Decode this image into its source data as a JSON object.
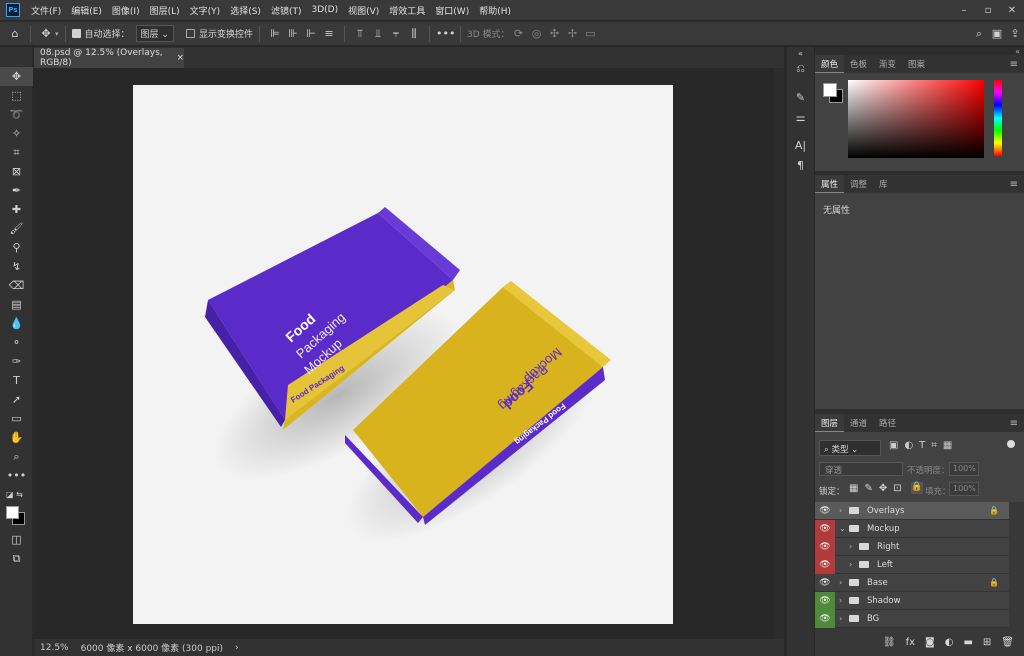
{
  "app": {
    "logo": "Ps"
  },
  "menu": [
    "文件(F)",
    "编辑(E)",
    "图像(I)",
    "图层(L)",
    "文字(Y)",
    "选择(S)",
    "滤镜(T)",
    "3D(D)",
    "视图(V)",
    "增效工具",
    "窗口(W)",
    "帮助(H)"
  ],
  "window_controls": {
    "minimize": "–",
    "restore": "▫",
    "close": "✕"
  },
  "options": {
    "auto_select_label": "自动选择：",
    "auto_select_value": "图层",
    "transform_label": "显示变换控件",
    "mode_3d": "3D 模式："
  },
  "document_tab": {
    "title": "08.psd @ 12.5% (Overlays, RGB/8)",
    "close": "×"
  },
  "status": {
    "zoom": "12.5%",
    "info": "6000 像素 x 6000 像素 (300 ppi)",
    "arrow": "›"
  },
  "color_panel": {
    "tabs": [
      "颜色",
      "色板",
      "渐变",
      "图案"
    ],
    "foreground": "#ffffff",
    "background": "#000000"
  },
  "properties_panel": {
    "tabs": [
      "属性",
      "调整",
      "库"
    ],
    "empty_text": "无属性"
  },
  "layers_panel": {
    "tabs": [
      "图层",
      "通道",
      "路径"
    ],
    "filter_kind": "类型",
    "blend_mode": "穿透",
    "opacity_label": "不透明度：",
    "opacity_value": "100%",
    "lock_label": "锁定：",
    "fill_label": "填充：",
    "fill_value": "100%"
  },
  "layers": [
    {
      "name": "Overlays",
      "indent": 0,
      "expanded": false,
      "locked": true,
      "tag": "none",
      "selected": true
    },
    {
      "name": "Mockup",
      "indent": 0,
      "expanded": true,
      "locked": false,
      "tag": "red",
      "selected": false
    },
    {
      "name": "Right",
      "indent": 1,
      "expanded": false,
      "locked": false,
      "tag": "red",
      "selected": false
    },
    {
      "name": "Left",
      "indent": 1,
      "expanded": false,
      "locked": false,
      "tag": "red",
      "selected": false
    },
    {
      "name": "Base",
      "indent": 0,
      "expanded": false,
      "locked": true,
      "tag": "none",
      "selected": false
    },
    {
      "name": "Shadow",
      "indent": 0,
      "expanded": false,
      "locked": false,
      "tag": "green",
      "selected": false
    },
    {
      "name": "BG",
      "indent": 0,
      "expanded": false,
      "locked": false,
      "tag": "green",
      "selected": false
    }
  ],
  "artwork": {
    "bag_left": {
      "lines": [
        "Food",
        "Packaging",
        "Mockup"
      ],
      "side": "Food Packaging",
      "color": "#5b2bc9",
      "accent": "#d9b520"
    },
    "bag_right": {
      "lines": [
        "Food",
        "Packaging",
        "Mockup"
      ],
      "side": "Food Packaging",
      "color": "#d8b31e",
      "accent": "#5b2bc9"
    }
  }
}
